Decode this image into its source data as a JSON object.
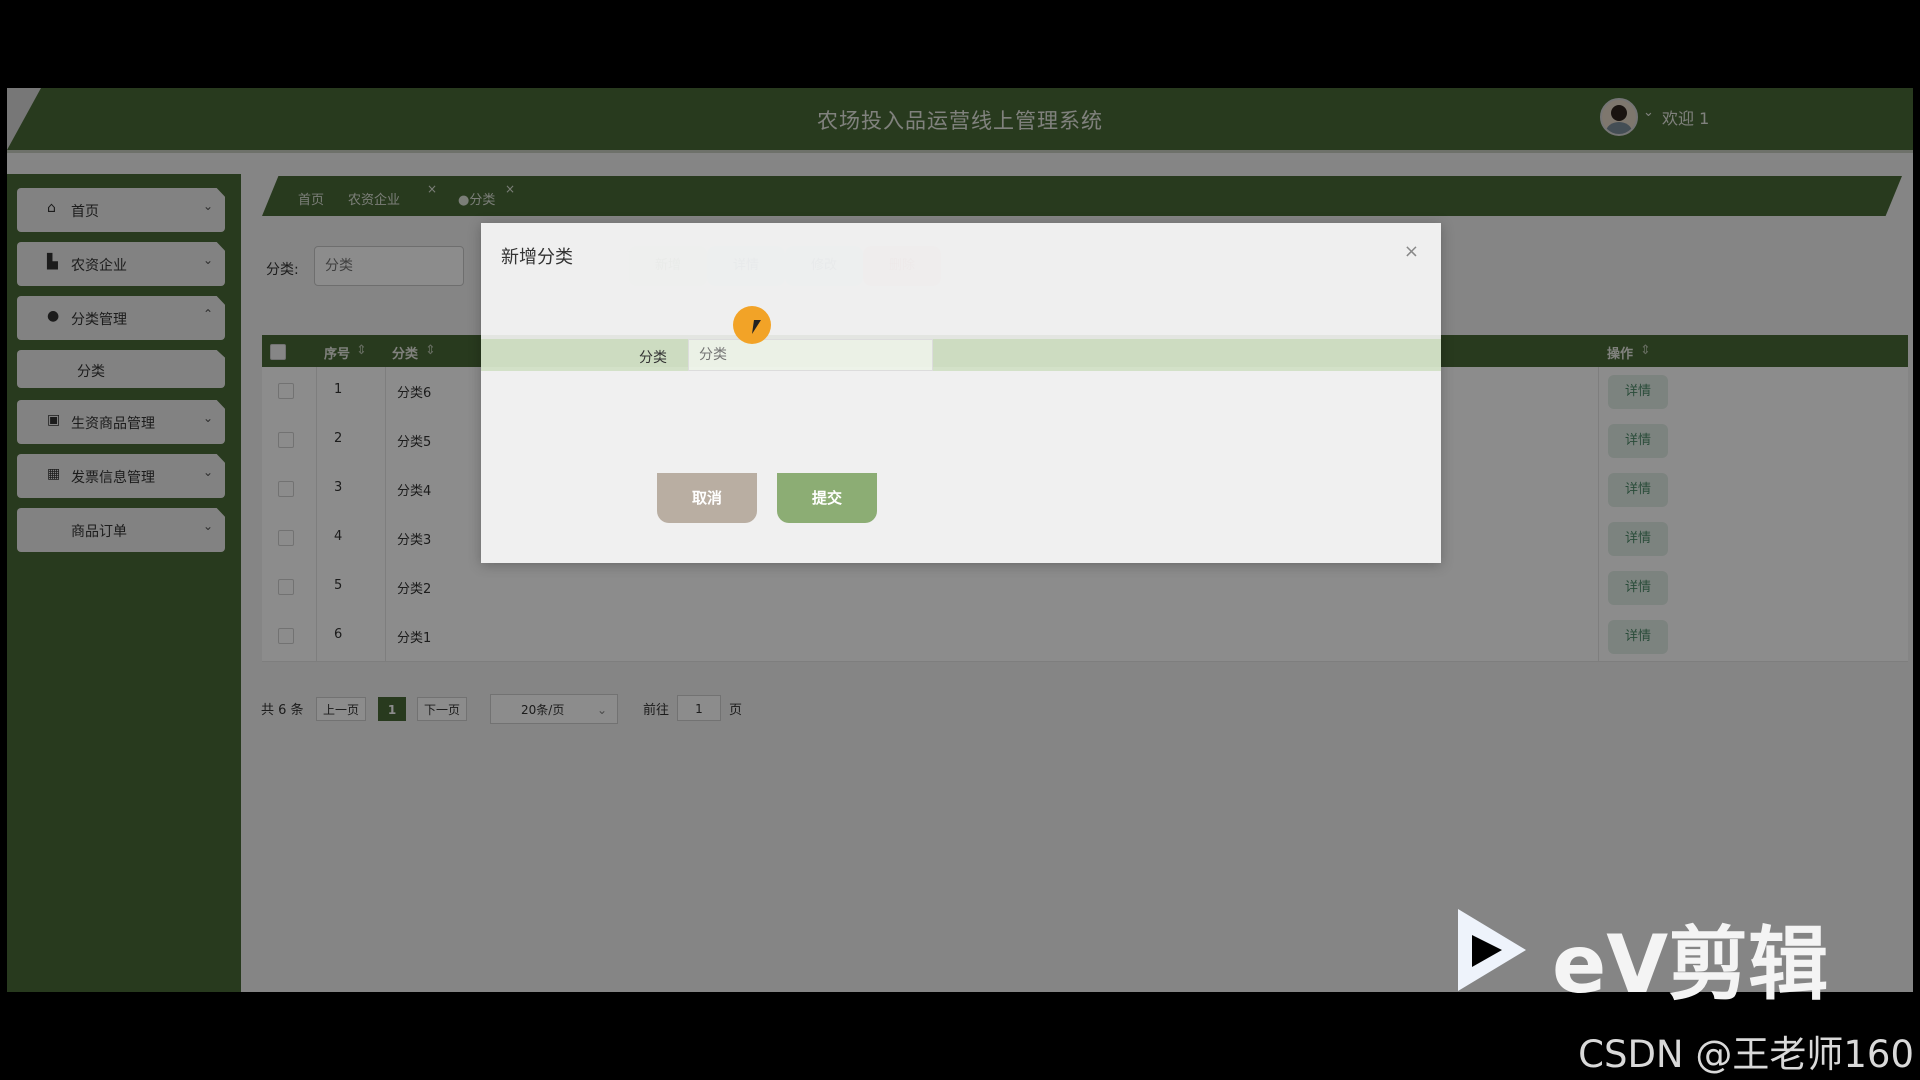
{
  "header": {
    "title": "农场投入品运营线上管理系统",
    "welcome": "欢迎 1",
    "caret": "⌄"
  },
  "sidebar": {
    "items": [
      {
        "label": "首页",
        "icon": "⌂",
        "chev": "⌄"
      },
      {
        "label": "农资企业",
        "icon": "▙",
        "chev": "⌄"
      },
      {
        "label": "分类管理",
        "icon": "●",
        "chev": "⌃"
      },
      {
        "label": "分类"
      },
      {
        "label": "生资商品管理",
        "icon": "▣",
        "chev": "⌄"
      },
      {
        "label": "发票信息管理",
        "icon": "▦",
        "chev": "⌄"
      },
      {
        "label": "商品订单",
        "chev": "⌄"
      }
    ]
  },
  "tabs": [
    {
      "label": "首页"
    },
    {
      "label": "农资企业",
      "close": "×"
    },
    {
      "label": "●分类",
      "close": "×"
    }
  ],
  "toolbar": {
    "filter_label": "分类:",
    "filter_placeholder": "分类",
    "buttons": [
      "新增",
      "详情",
      "修改",
      "删除"
    ]
  },
  "table": {
    "headers": [
      "序号",
      "分类",
      "操作"
    ],
    "sort_icon": "⇕",
    "action_label": "详情",
    "rows": [
      {
        "no": "1",
        "name": "分类6"
      },
      {
        "no": "2",
        "name": "分类5"
      },
      {
        "no": "3",
        "name": "分类4"
      },
      {
        "no": "4",
        "name": "分类3"
      },
      {
        "no": "5",
        "name": "分类2"
      },
      {
        "no": "6",
        "name": "分类1"
      }
    ]
  },
  "pagination": {
    "total": "共 6 条",
    "prev": "上一页",
    "current": "1",
    "next": "下一页",
    "page_size": "20条/页",
    "goto_label": "前往",
    "goto_value": "1",
    "page_suffix": "页"
  },
  "dialog": {
    "title": "新增分类",
    "close": "×",
    "field_label": "分类",
    "field_placeholder": "分类",
    "cancel": "取消",
    "submit": "提交"
  },
  "watermark": {
    "ev": "eV剪辑",
    "csdn": "CSDN @王老师160"
  },
  "colors": {
    "brand_green": "#4a6a38",
    "cancel_btn": "#b9aea2",
    "submit_btn": "#8cad74",
    "cursor_highlight": "#f2a327"
  }
}
